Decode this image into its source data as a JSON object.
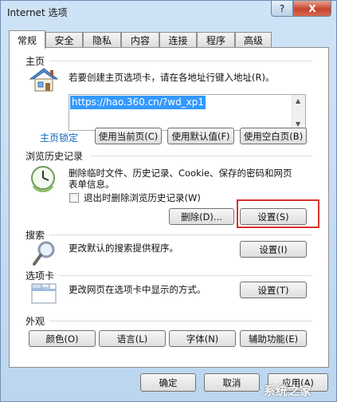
{
  "window": {
    "title": "Internet 选项",
    "help_label": "?",
    "close_label": "X"
  },
  "tabs": [
    "常规",
    "安全",
    "隐私",
    "内容",
    "连接",
    "程序",
    "高级"
  ],
  "home": {
    "label": "主页",
    "desc": "若要创建主页选项卡，请在各地址行键入地址(R)。",
    "url": "https://hao.360.cn/?wd_xp1",
    "lock_link": "主页锁定",
    "use_current": "使用当前页(C)",
    "use_default": "使用默认值(F)",
    "use_blank": "使用空白页(B)"
  },
  "history": {
    "label": "浏览历史记录",
    "desc_line1": "删除临时文件、历史记录、Cookie、保存的密码和网页",
    "desc_line2": "表单信息。",
    "checkbox_label": "退出时删除浏览历史记录(W)",
    "delete_label": "删除(D)...",
    "settings_label": "设置(S)"
  },
  "search": {
    "label": "搜索",
    "desc": "更改默认的搜索提供程序。",
    "settings_label": "设置(I)"
  },
  "tabs_section": {
    "label": "选项卡",
    "desc": "更改网页在选项卡中显示的方式。",
    "settings_label": "设置(T)"
  },
  "appearance": {
    "label": "外观",
    "colors": "颜色(O)",
    "languages": "语言(L)",
    "fonts": "字体(N)",
    "accessibility": "辅助功能(E)"
  },
  "footer": {
    "ok": "确定",
    "cancel": "取消",
    "apply": "应用(A)"
  },
  "watermark": "系统之家",
  "highlight_color": "#d9302c"
}
